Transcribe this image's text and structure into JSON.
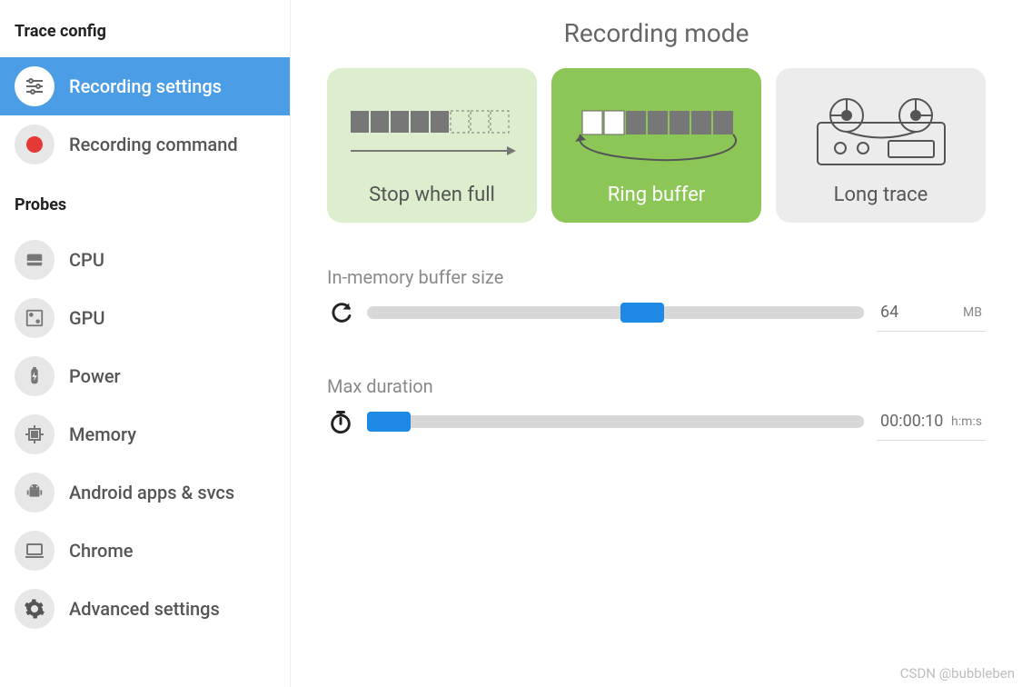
{
  "sidebar": {
    "section1_title": "Trace config",
    "section2_title": "Probes",
    "config_items": [
      {
        "label": "Recording settings",
        "active": true
      },
      {
        "label": "Recording command",
        "active": false
      }
    ],
    "probe_items": [
      {
        "label": "CPU"
      },
      {
        "label": "GPU"
      },
      {
        "label": "Power"
      },
      {
        "label": "Memory"
      },
      {
        "label": "Android apps & svcs"
      },
      {
        "label": "Chrome"
      },
      {
        "label": "Advanced settings"
      }
    ]
  },
  "main": {
    "heading": "Recording mode",
    "modes": [
      {
        "label": "Stop when full",
        "selected": false
      },
      {
        "label": "Ring buffer",
        "selected": true
      },
      {
        "label": "Long trace",
        "selected": false
      }
    ],
    "buffer": {
      "label": "In-memory buffer size",
      "value": "64",
      "unit": "MB",
      "percent": 51
    },
    "duration": {
      "label": "Max duration",
      "value": "00:00:10",
      "unit": "h:m:s",
      "percent": 2
    }
  },
  "watermark": "CSDN @bubbleben"
}
